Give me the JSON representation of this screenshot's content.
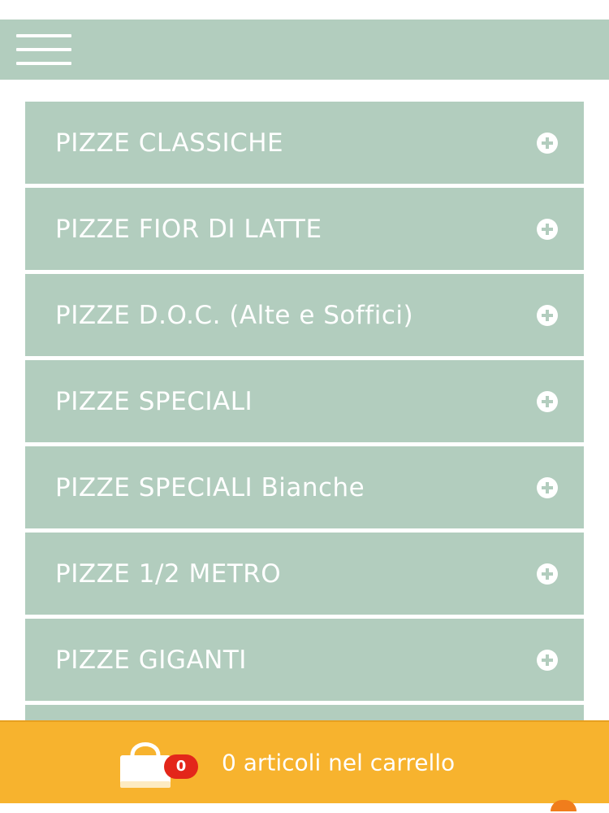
{
  "header": {
    "menu_icon": "hamburger-menu-icon",
    "background": "#b2cdbe"
  },
  "categories": [
    {
      "label": "PIZZE CLASSICHE",
      "icon": "plus-circle-icon"
    },
    {
      "label": "PIZZE FIOR DI LATTE",
      "icon": "plus-circle-icon"
    },
    {
      "label": "PIZZE D.O.C. (Alte e Soffici)",
      "icon": "plus-circle-icon"
    },
    {
      "label": "PIZZE SPECIALI",
      "icon": "plus-circle-icon"
    },
    {
      "label": "PIZZE SPECIALI Bianche",
      "icon": "plus-circle-icon"
    },
    {
      "label": "PIZZE 1/2 METRO",
      "icon": "plus-circle-icon"
    },
    {
      "label": "PIZZE GIGANTI",
      "icon": "plus-circle-icon"
    },
    {
      "label": "",
      "icon": ""
    }
  ],
  "cart": {
    "count": "0",
    "label": "0 articoli nel carrello",
    "icon": "shopping-bag-icon",
    "background": "#f7b32e",
    "badge_color": "#e3261a"
  },
  "colors": {
    "accent": "#b2cdbe",
    "text": "#ffffff",
    "cart": "#f7b32e",
    "badge": "#e3261a"
  }
}
